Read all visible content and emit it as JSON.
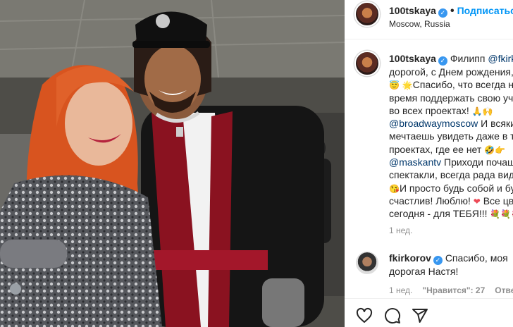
{
  "header": {
    "username": "100tskaya",
    "verified": true,
    "separator": "•",
    "follow_label": "Подписаться",
    "location": "Moscow, Russia"
  },
  "caption": {
    "username": "100tskaya",
    "lines": [
      {
        "text": "Филипп ",
        "mention": "@fkirkorov"
      },
      {
        "text": "дорогой, с Днем рождения, мой"
      },
      {
        "text": "Спасибо, что всегда находишь"
      },
      {
        "text": "время поддержать свою ученицу"
      },
      {
        "text": "во всех проектах!"
      },
      {
        "mention": "@broadwaymoscow",
        "text": " И всякий раз"
      },
      {
        "text": "мечтаешь увидеть даже в тех"
      },
      {
        "text": "проектах, где ее нет"
      },
      {
        "mention": "@maskantv",
        "text": " Приходи почаще на"
      },
      {
        "text": "спектакли, всегда рада видеть"
      },
      {
        "text": "И просто будь собой и будь"
      },
      {
        "text": "счастлив! Люблю!",
        "tail": " Все цветы"
      },
      {
        "text": "сегодня - для ТЕБЯ!!!"
      }
    ],
    "time": "1 нед."
  },
  "reply": {
    "username": "fkirkorov",
    "verified": true,
    "text_line1": "Спасибо, моя",
    "text_line2": "дорогая Настя!",
    "time": "1 нед.",
    "likes": "\"Нравится\": 27",
    "reply_label": "Ответить"
  },
  "colors": {
    "accent": "#0095f6",
    "link": "#00376b",
    "verified": "#3897f0",
    "muted": "#8e8e8e"
  },
  "icons": [
    "heart-icon",
    "comment-icon",
    "share-icon"
  ]
}
